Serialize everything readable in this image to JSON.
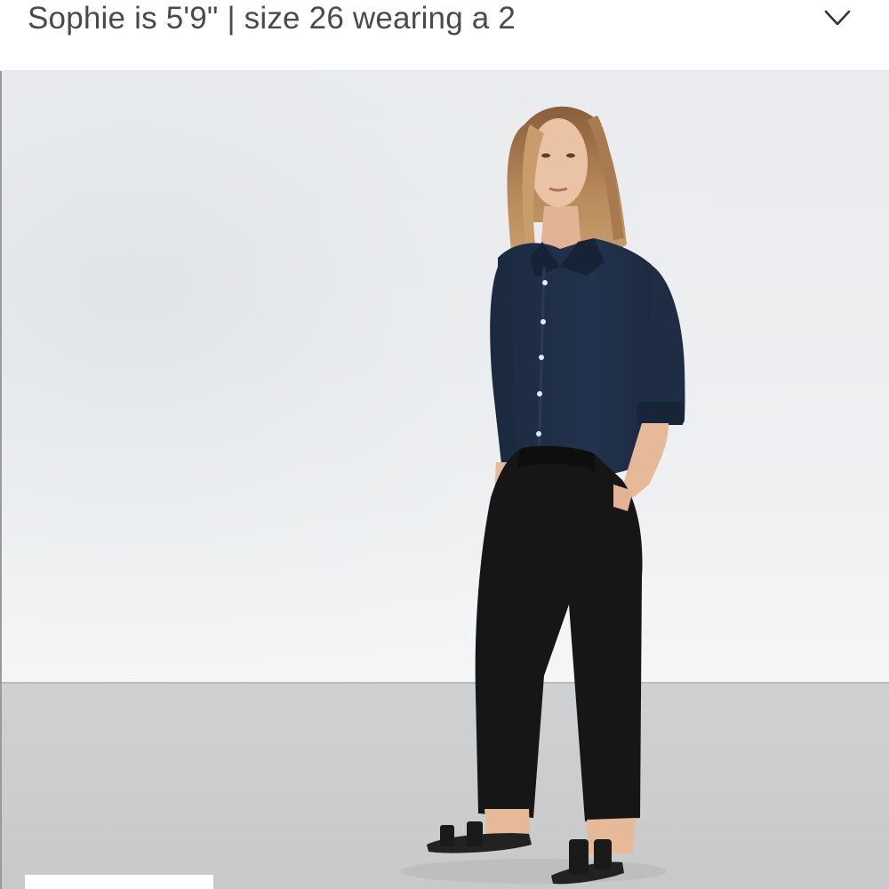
{
  "header": {
    "caption": "Sophie is 5'9\" | size 26 wearing a 2",
    "toggle_icon": "chevron-down-icon"
  },
  "photo": {
    "subject": "model-photo"
  }
}
